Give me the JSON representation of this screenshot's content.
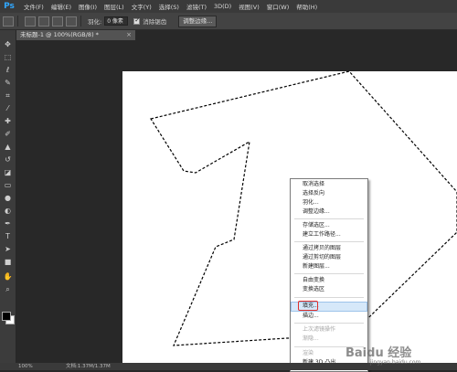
{
  "app": {
    "logo_text": "Ps"
  },
  "menubar": {
    "items": [
      "文件(F)",
      "编辑(E)",
      "图像(I)",
      "图层(L)",
      "文字(Y)",
      "选择(S)",
      "滤镜(T)",
      "3D(D)",
      "视图(V)",
      "窗口(W)",
      "帮助(H)"
    ]
  },
  "options": {
    "feather_label": "羽化:",
    "feather_value": "0 像素",
    "antialias_label": "消除锯齿",
    "refine_edge_label": "调整边缘..."
  },
  "document": {
    "tab_title": "未标题-1 @ 100%(RGB/8) *",
    "close_glyph": "×"
  },
  "status": {
    "zoom": "100%",
    "doc_size": "文档:1.37M/1.37M"
  },
  "context_menu": {
    "items": [
      {
        "label": "取消选择",
        "enabled": true
      },
      {
        "label": "选择反向",
        "enabled": true
      },
      {
        "label": "羽化...",
        "enabled": true
      },
      {
        "label": "调整边缘...",
        "enabled": true
      },
      {
        "label": "存储选区...",
        "enabled": true
      },
      {
        "label": "建立工作路径...",
        "enabled": true
      },
      {
        "label": "通过拷贝的图层",
        "enabled": true
      },
      {
        "label": "通过剪切的图层",
        "enabled": true
      },
      {
        "label": "新建图层...",
        "enabled": true
      },
      {
        "label": "自由变换",
        "enabled": true
      },
      {
        "label": "变换选区",
        "enabled": true
      },
      {
        "label": "填充...",
        "enabled": true
      },
      {
        "label": "描边...",
        "enabled": true
      },
      {
        "label": "上次滤镜操作",
        "enabled": false
      },
      {
        "label": "渐隐...",
        "enabled": false
      },
      {
        "label": "渲染",
        "enabled": false
      },
      {
        "label": "新建 3D 凸出",
        "enabled": true
      }
    ],
    "highlighted": "填充..."
  },
  "watermark": {
    "text": "Baidu 经验",
    "sub": "jingyan.baidu.com"
  },
  "colors": {
    "accent": "#31a8ff",
    "highlight_border": "#e0302a",
    "canvas": "#ffffff",
    "workspace": "#282828"
  },
  "icons": [
    "move-icon",
    "marquee-icon",
    "lasso-icon",
    "quick-select-icon",
    "crop-icon",
    "eyedropper-icon",
    "heal-icon",
    "brush-icon",
    "stamp-icon",
    "history-brush-icon",
    "eraser-icon",
    "gradient-icon",
    "blur-icon",
    "dodge-icon",
    "pen-icon",
    "type-icon",
    "path-select-icon",
    "shape-icon",
    "hand-icon",
    "zoom-icon"
  ]
}
